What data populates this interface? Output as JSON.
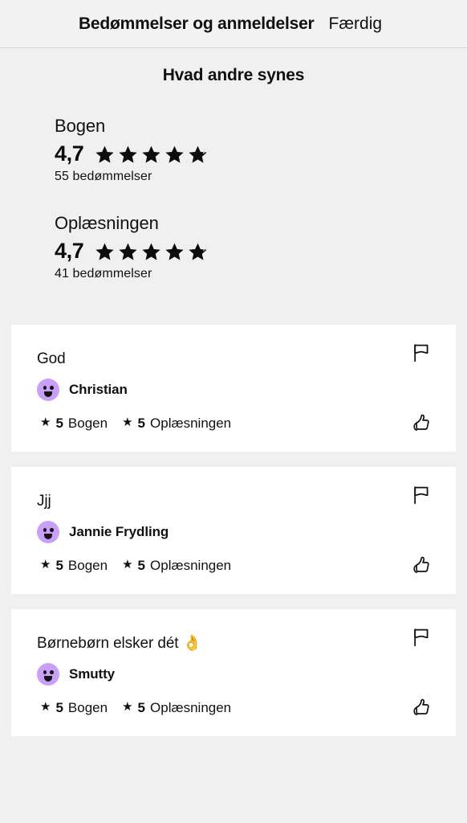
{
  "header": {
    "title": "Bedømmelser og anmeldelser",
    "done_label": "Færdig"
  },
  "summary": {
    "title": "Hvad andre synes",
    "ratings": [
      {
        "subject": "Bogen",
        "value": "4,7",
        "stars": 5,
        "count_label": "55 bedømmelser"
      },
      {
        "subject": "Oplæsningen",
        "value": "4,7",
        "stars": 5,
        "count_label": "41 bedømmelser"
      }
    ]
  },
  "reviews": [
    {
      "title": "God",
      "author": "Christian",
      "book_score": "5",
      "book_label": "Bogen",
      "narration_score": "5",
      "narration_label": "Oplæsningen",
      "flag_icon": "flag-icon",
      "like_icon": "thumbs-up-icon",
      "avatar_icon": "smiley-avatar-icon"
    },
    {
      "title": "Jjj",
      "author": "Jannie Frydling",
      "book_score": "5",
      "book_label": "Bogen",
      "narration_score": "5",
      "narration_label": "Oplæsningen",
      "flag_icon": "flag-icon",
      "like_icon": "thumbs-up-icon",
      "avatar_icon": "smiley-avatar-icon"
    },
    {
      "title": "Børnebørn elsker dét 👌",
      "author": "Smutty",
      "book_score": "5",
      "book_label": "Bogen",
      "narration_score": "5",
      "narration_label": "Oplæsningen",
      "flag_icon": "flag-icon",
      "like_icon": "thumbs-up-icon",
      "avatar_icon": "smiley-avatar-icon"
    }
  ],
  "icons": {
    "star_glyph": "★"
  },
  "colors": {
    "page_background": "#f0f0f0",
    "card_background": "#ffffff",
    "avatar_purple": "#c9a0f7",
    "text": "#111111",
    "header_border": "#d8d8d8"
  }
}
